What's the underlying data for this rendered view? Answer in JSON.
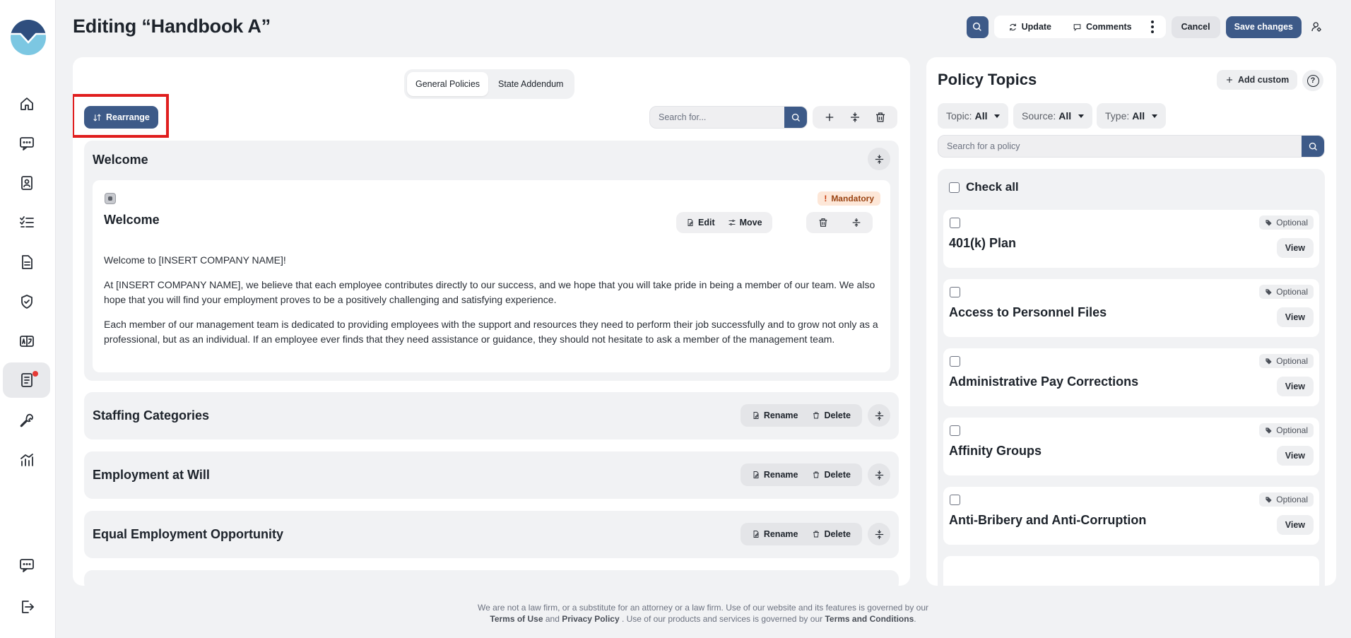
{
  "header": {
    "title": "Editing “Handbook A”",
    "update_label": "Update",
    "comments_label": "Comments",
    "cancel_label": "Cancel",
    "save_label": "Save changes"
  },
  "editor": {
    "tabs": [
      {
        "label": "General Policies",
        "active": true
      },
      {
        "label": "State Addendum",
        "active": false
      }
    ],
    "rearrange_label": "Rearrange",
    "search_placeholder": "Search for...",
    "sections": [
      {
        "title": "Welcome",
        "expanded": true,
        "policy": {
          "name": "Welcome",
          "badge": "Mandatory",
          "badge_mark": "!",
          "edit_label": "Edit",
          "move_label": "Move",
          "paragraphs": [
            "Welcome to [INSERT COMPANY NAME]!",
            "At [INSERT COMPANY NAME], we believe that each employee contributes directly to our success, and we hope that you will take pride in being a member of our team. We also hope that you will find your employment proves to be a positively challenging and satisfying experience.",
            "Each member of our management team is dedicated to providing employees with the support and resources they need to perform their job successfully and to grow not only as a professional, but as an individual. If an employee ever finds that they need assistance or guidance, they should not hesitate to ask a member of the management team."
          ]
        }
      },
      {
        "title": "Staffing Categories",
        "rename_label": "Rename",
        "delete_label": "Delete"
      },
      {
        "title": "Employment at Will",
        "rename_label": "Rename",
        "delete_label": "Delete"
      },
      {
        "title": "Equal Employment Opportunity",
        "rename_label": "Rename",
        "delete_label": "Delete"
      }
    ]
  },
  "topics": {
    "title": "Policy Topics",
    "add_custom_label": "Add custom",
    "help_label": "?",
    "filters": [
      {
        "name": "Topic:",
        "value": "All"
      },
      {
        "name": "Source:",
        "value": "All"
      },
      {
        "name": "Type:",
        "value": "All"
      }
    ],
    "search_placeholder": "Search for a policy",
    "check_all_label": "Check all",
    "items": [
      {
        "name": "401(k) Plan",
        "badge": "Optional",
        "view_label": "View"
      },
      {
        "name": "Access to Personnel Files",
        "badge": "Optional",
        "view_label": "View"
      },
      {
        "name": "Administrative Pay Corrections",
        "badge": "Optional",
        "view_label": "View"
      },
      {
        "name": "Affinity Groups",
        "badge": "Optional",
        "view_label": "View"
      },
      {
        "name": "Anti-Bribery and Anti-Corruption",
        "badge": "Optional",
        "view_label": "View"
      }
    ]
  },
  "footer": {
    "line1": "We are not a law firm, or a substitute for an attorney or a law firm. Use of our website and its features is governed by our",
    "terms_of_use": "Terms of Use",
    "and": "and",
    "privacy_policy": "Privacy Policy",
    "line2_middle": ". Use of our products and services is governed by our",
    "terms_and_conditions": "Terms and Conditions",
    "period": "."
  },
  "colors": {
    "accent": "#3d5a88",
    "highlight": "#e01e1e",
    "mandatory_bg": "#fde7d8",
    "notification_dot": "#e53935"
  }
}
